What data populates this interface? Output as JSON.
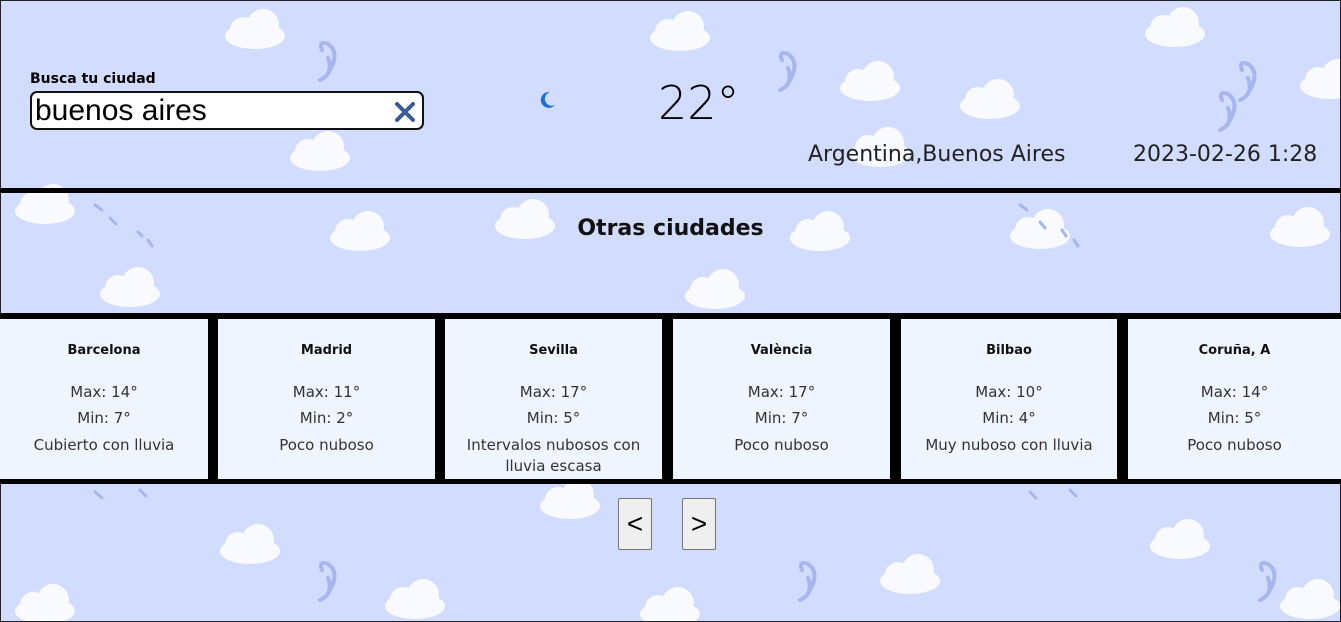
{
  "search": {
    "label": "Busca tu ciudad",
    "value": "buenos aires",
    "clear_icon": "close-icon"
  },
  "current": {
    "condition_icon": "moon-icon",
    "temperature": "22°",
    "location": "Argentina,Buenos Aires",
    "datetime": "2023-02-26 1:28"
  },
  "other_cities": {
    "title": "Otras ciudades",
    "cities": [
      {
        "name": "Barcelona",
        "max": "Max: 14°",
        "min": "Min: 7°",
        "description": "Cubierto con lluvia"
      },
      {
        "name": "Madrid",
        "max": "Max: 11°",
        "min": "Min: 2°",
        "description": "Poco nuboso"
      },
      {
        "name": "Sevilla",
        "max": "Max: 17°",
        "min": "Min: 5°",
        "description": "Intervalos nubosos con lluvia escasa"
      },
      {
        "name": "València",
        "max": "Max: 17°",
        "min": "Min: 7°",
        "description": "Poco nuboso"
      },
      {
        "name": "Bilbao",
        "max": "Max: 10°",
        "min": "Min: 4°",
        "description": "Muy nuboso con lluvia"
      },
      {
        "name": "Coruña, A",
        "max": "Max: 14°",
        "min": "Min: 5°",
        "description": "Poco nuboso"
      }
    ]
  },
  "pagination": {
    "prev_label": "<",
    "next_label": ">"
  },
  "colors": {
    "background": "#d2dcff",
    "card_background": "#eef5ff",
    "clear_icon": "#3a5a99",
    "moon_icon": "#1a6fd6"
  }
}
